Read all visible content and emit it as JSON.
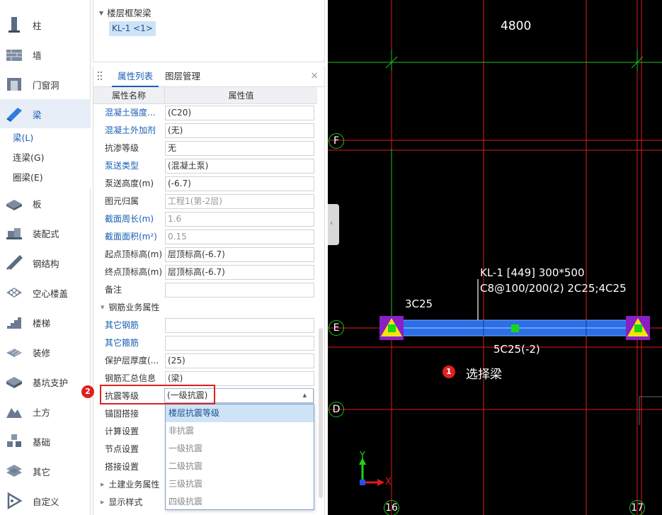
{
  "nav": {
    "items": [
      {
        "id": "column",
        "label": "柱",
        "icon": "column-icon"
      },
      {
        "id": "wall",
        "label": "墙",
        "icon": "wall-icon"
      },
      {
        "id": "door-window",
        "label": "门窗洞",
        "icon": "door-window-icon"
      },
      {
        "id": "beam",
        "label": "梁",
        "icon": "beam-icon",
        "active": true
      },
      {
        "id": "slab",
        "label": "板",
        "icon": "slab-icon"
      },
      {
        "id": "prefab",
        "label": "装配式",
        "icon": "prefab-icon"
      },
      {
        "id": "steel",
        "label": "钢结构",
        "icon": "steel-structure-icon"
      },
      {
        "id": "hollow-floor",
        "label": "空心楼盖",
        "icon": "hollow-floor-icon"
      },
      {
        "id": "stairs",
        "label": "楼梯",
        "icon": "stairs-icon"
      },
      {
        "id": "decoration",
        "label": "装修",
        "icon": "decoration-icon"
      },
      {
        "id": "pit-support",
        "label": "基坑支护",
        "icon": "pit-support-icon"
      },
      {
        "id": "earthwork",
        "label": "土方",
        "icon": "earthwork-icon"
      },
      {
        "id": "foundation",
        "label": "基础",
        "icon": "foundation-icon"
      },
      {
        "id": "other",
        "label": "其它",
        "icon": "other-icon"
      },
      {
        "id": "custom",
        "label": "自定义",
        "icon": "custom-icon"
      }
    ],
    "sub_items": [
      {
        "label": "梁(L)",
        "active": true
      },
      {
        "label": "连梁(G)"
      },
      {
        "label": "圈梁(E)"
      }
    ]
  },
  "tree": {
    "group": "楼层框架梁",
    "leaf": "KL-1 <1>"
  },
  "panel": {
    "tab_attr": "属性列表",
    "tab_layer": "图层管理",
    "close": "×",
    "col_name": "属性名称",
    "col_value": "属性值",
    "rows": [
      {
        "name": "混凝土强度...",
        "value": "(C20)",
        "link": true
      },
      {
        "name": "混凝土外加剂",
        "value": "(无)",
        "link": true
      },
      {
        "name": "抗渗等级",
        "value": "无"
      },
      {
        "name": "泵送类型",
        "value": "(混凝土泵)",
        "link": true
      },
      {
        "name": "泵送高度(m)",
        "value": "(-6.7)"
      },
      {
        "name": "图元归属",
        "value": "工程1(第-2层)",
        "gray": true
      },
      {
        "name": "截面周长(m)",
        "value": "1.6",
        "link": true,
        "gray": true
      },
      {
        "name": "截面面积(m²)",
        "value": "0.15",
        "link": true,
        "gray": true
      },
      {
        "name": "起点顶标高(m)",
        "value": "层顶标高(-6.7)"
      },
      {
        "name": "终点顶标高(m)",
        "value": "层顶标高(-6.7)"
      },
      {
        "name": "备注",
        "value": ""
      }
    ],
    "group_rebar": "钢筋业务属性",
    "rebar_rows": [
      {
        "name": "其它钢筋",
        "value": "",
        "link": true
      },
      {
        "name": "其它箍筋",
        "value": "",
        "link": true
      },
      {
        "name": "保护层厚度(...",
        "value": "(25)"
      },
      {
        "name": "钢筋汇总信息",
        "value": "(梁)"
      },
      {
        "name": "抗震等级",
        "value": "(一级抗震)"
      },
      {
        "name": "锚固搭接",
        "value": ""
      },
      {
        "name": "计算设置",
        "value": ""
      },
      {
        "name": "节点设置",
        "value": ""
      },
      {
        "name": "搭接设置",
        "value": ""
      }
    ],
    "group_civil": "土建业务属性",
    "group_display": "显示样式"
  },
  "dropdown": {
    "current": "(一级抗震)",
    "options": [
      {
        "label": "楼层抗震等级",
        "selected": true
      },
      {
        "label": "非抗震"
      },
      {
        "label": "一级抗震"
      },
      {
        "label": "二级抗震"
      },
      {
        "label": "三级抗震"
      },
      {
        "label": "四级抗震"
      }
    ]
  },
  "badges": {
    "one": "1",
    "two": "2"
  },
  "canvas": {
    "dimension": "4800",
    "axis_F": "F",
    "axis_E": "E",
    "axis_D": "D",
    "axis_16": "16",
    "axis_17": "17",
    "beam_label_1": "KL-1 [449] 300*500",
    "beam_label_2": "C8@100/200(2) 2C25;4C25",
    "top_rebar": "3C25",
    "bottom_rebar": "5C25(-2)",
    "step1": "选择梁",
    "ucs_y": "Y",
    "ucs_x": "X",
    "colors": {
      "background": "#000000",
      "grid": "#e01a1a",
      "beam": "#2a6ee8",
      "support": "#8a1fc7",
      "marker": "#f5e600",
      "node": "#19d619"
    }
  }
}
